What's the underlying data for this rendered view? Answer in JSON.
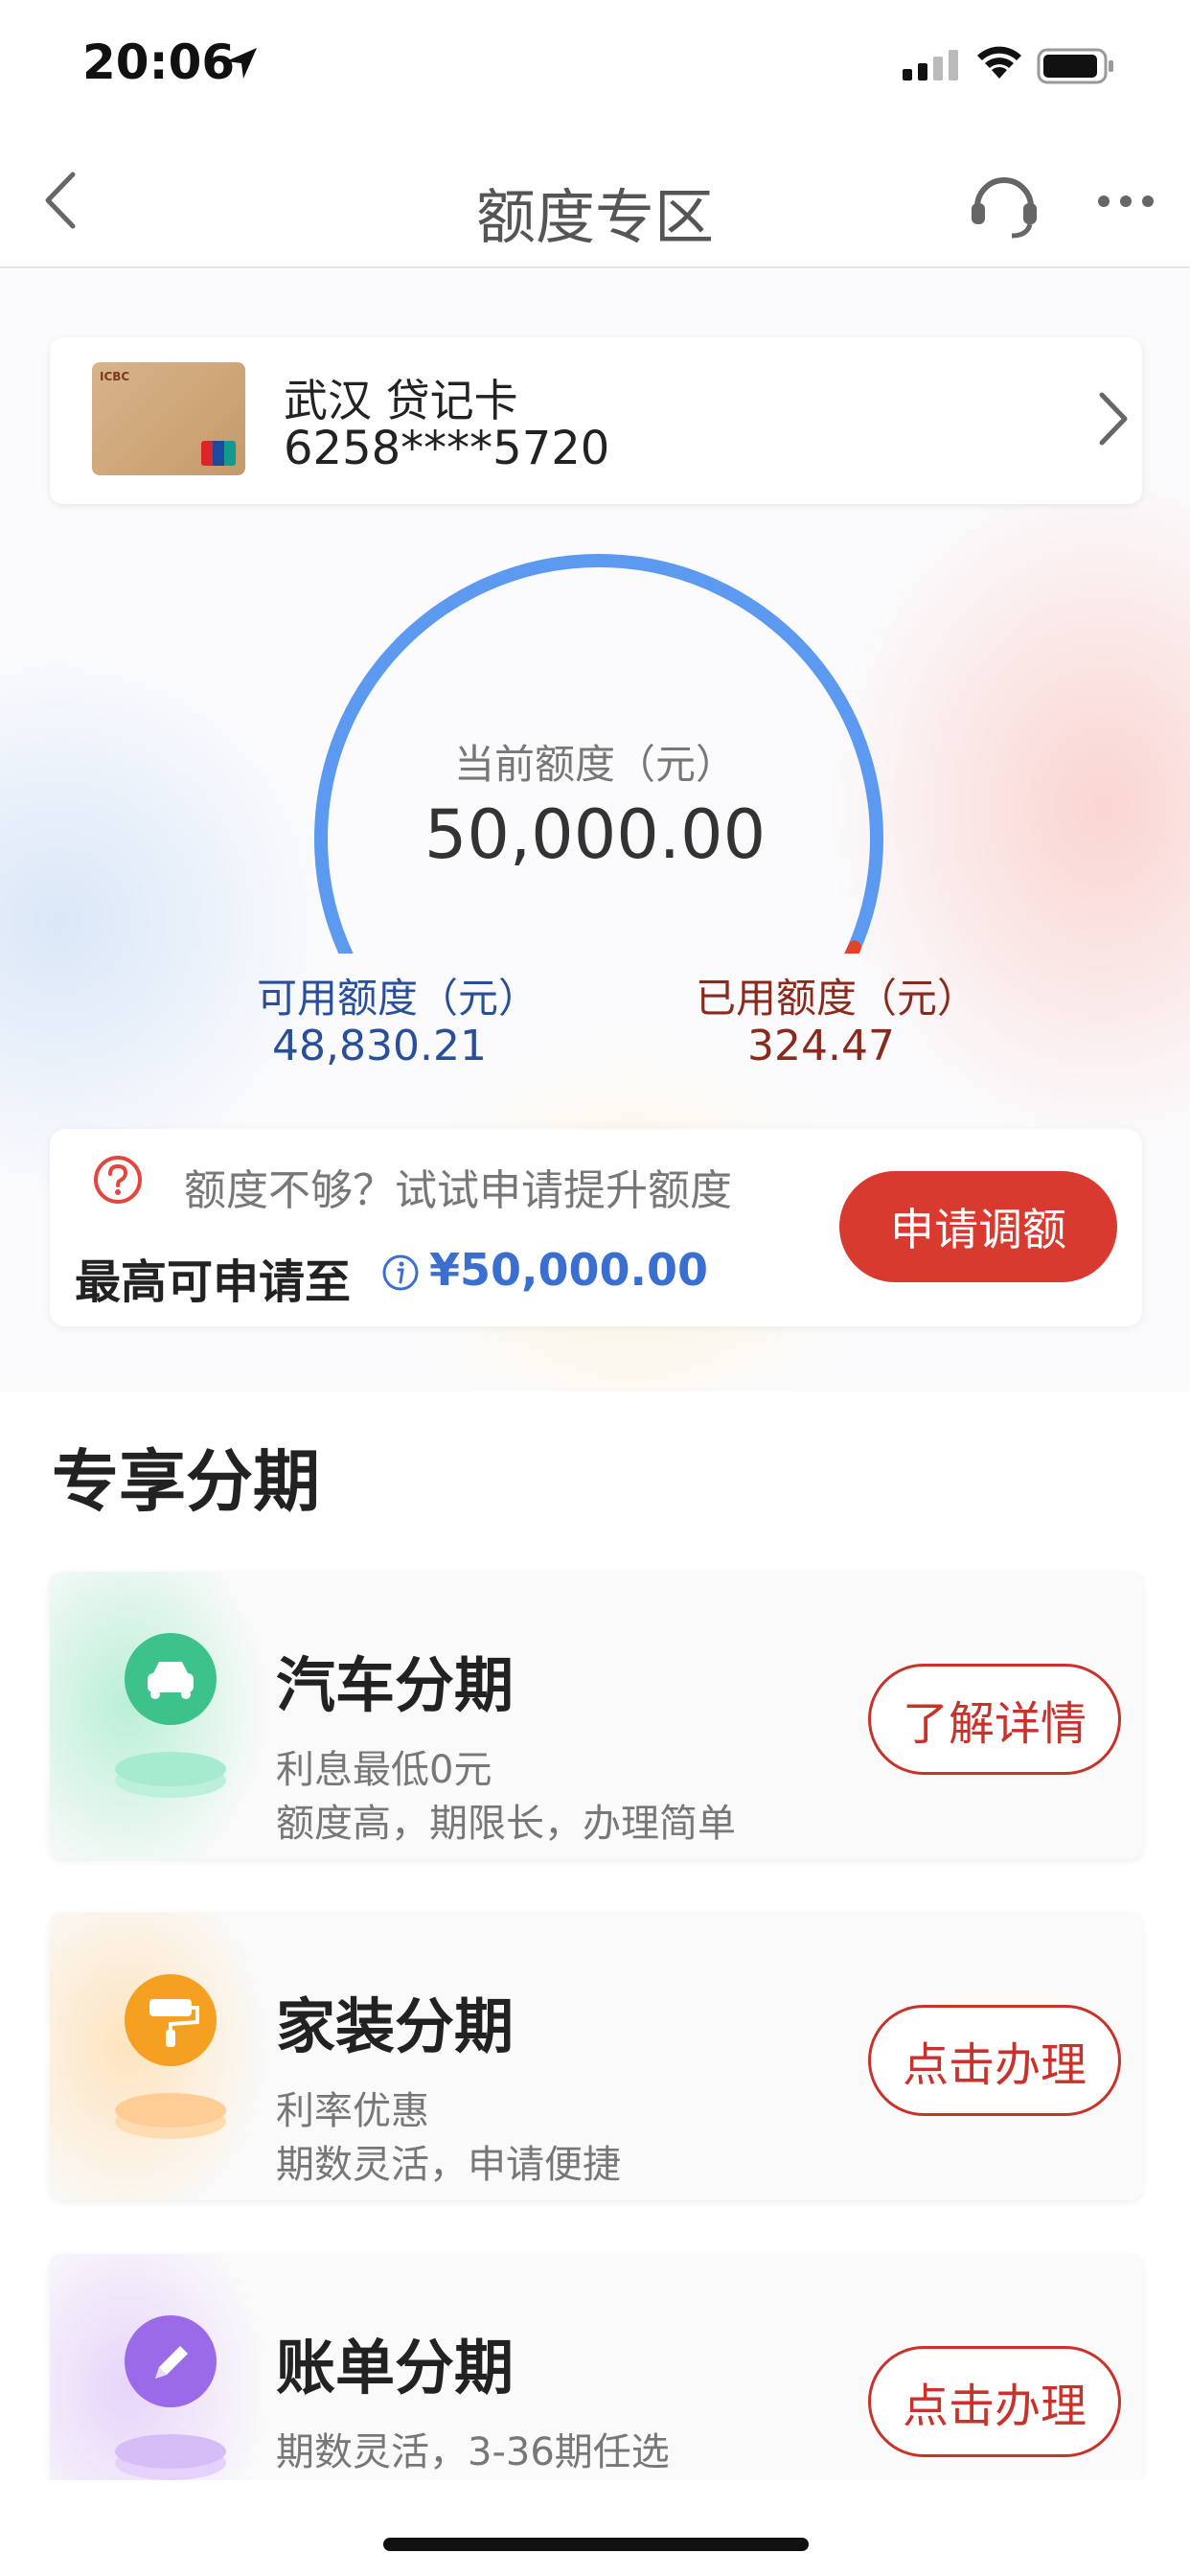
{
  "status_bar": {
    "time": "20:06"
  },
  "nav": {
    "title": "额度专区"
  },
  "card": {
    "name": "武汉 贷记卡",
    "number": "6258****5720"
  },
  "gauge": {
    "title": "当前额度（元）",
    "value": "50,000.00",
    "available_label": "可用额度（元）",
    "available_value": "48,830.21",
    "used_label": "已用额度（元）",
    "used_value": "324.47",
    "arc_color": "#5b9af0",
    "used_color": "#e0452a"
  },
  "raise": {
    "hint": "额度不够？试试申请提升额度",
    "max_label": "最高可申请至",
    "max_value": "¥50,000.00",
    "button": "申请调额"
  },
  "section": {
    "title": "专享分期"
  },
  "products": [
    {
      "title": "汽车分期",
      "sub1": "利息最低0元",
      "sub2": "额度高，期限长，办理简单",
      "button": "了解详情",
      "icon": "car-icon",
      "color": "#3cc28a"
    },
    {
      "title": "家装分期",
      "sub1": "利率优惠",
      "sub2": "期数灵活，申请便捷",
      "button": "点击办理",
      "icon": "paint-roller-icon",
      "color": "#f5a020"
    },
    {
      "title": "账单分期",
      "sub1": "期数灵活，3-36期任选",
      "sub2": "",
      "button": "点击办理",
      "icon": "pencil-icon",
      "color": "#9a6ae8"
    }
  ]
}
